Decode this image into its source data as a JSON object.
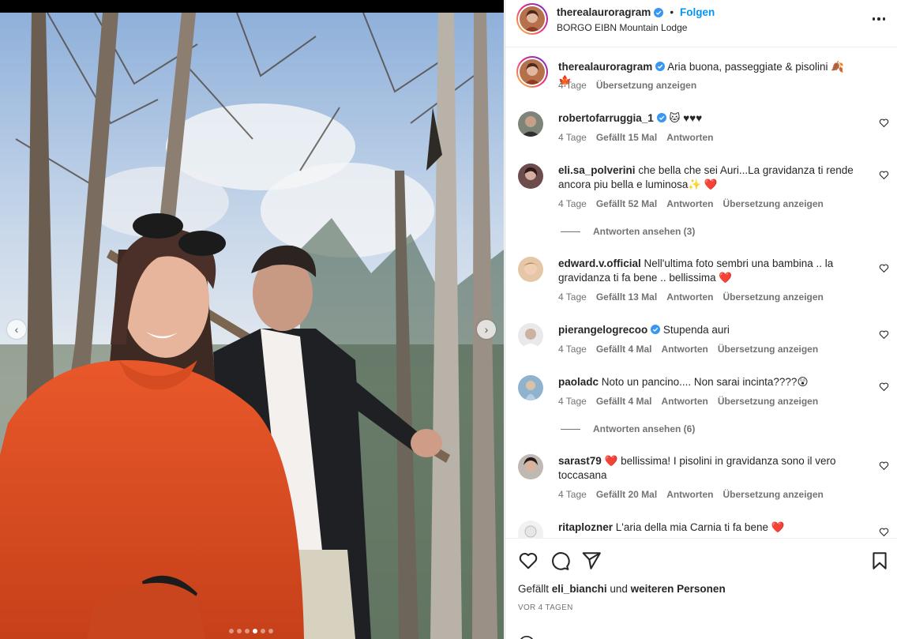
{
  "post": {
    "username": "therealauroragram",
    "verified": true,
    "separator": "•",
    "follow_label": "Folgen",
    "location": "BORGO EIBN Mountain Lodge",
    "more_icon": "more-horizontal-icon"
  },
  "media": {
    "prev_icon": "‹",
    "next_icon": "›",
    "slide_count": 6,
    "active_slide": 4
  },
  "caption": {
    "username": "therealauroragram",
    "text": "Aria buona, passeggiate & pisolini 🍂 🍁",
    "time": "4 Tage",
    "translate": "Übersetzung anzeigen"
  },
  "comments": [
    {
      "username": "robertofarruggia_1",
      "verified": true,
      "text": "🐱 ♥♥♥",
      "time": "4 Tage",
      "likes": "Gefällt 15 Mal",
      "reply": "Antworten",
      "translate": ""
    },
    {
      "username": "eli.sa_polverini",
      "verified": false,
      "text": "che bella che sei Auri...La gravidanza ti rende ancora piu bella e luminosa✨ ❤️",
      "time": "4 Tage",
      "likes": "Gefällt 52 Mal",
      "reply": "Antworten",
      "translate": "Übersetzung anzeigen",
      "view_replies": "Antworten ansehen (3)"
    },
    {
      "username": "edward.v.official",
      "verified": false,
      "text": "Nell'ultima foto sembri una bambina .. la gravidanza ti fa bene .. bellissima ❤️",
      "time": "4 Tage",
      "likes": "Gefällt 13 Mal",
      "reply": "Antworten",
      "translate": "Übersetzung anzeigen"
    },
    {
      "username": "pierangelogrecoo",
      "verified": true,
      "text": "Stupenda auri",
      "time": "4 Tage",
      "likes": "Gefällt 4 Mal",
      "reply": "Antworten",
      "translate": "Übersetzung anzeigen"
    },
    {
      "username": "paoladc",
      "verified": false,
      "text": "Noto un pancino.... Non sarai incinta????😲",
      "time": "4 Tage",
      "likes": "Gefällt 4 Mal",
      "reply": "Antworten",
      "translate": "Übersetzung anzeigen",
      "view_replies": "Antworten ansehen (6)"
    },
    {
      "username": "sarast79",
      "verified": false,
      "text": "❤️ bellissima! I pisolini in gravidanza sono il vero toccasana",
      "time": "4 Tage",
      "likes": "Gefällt 20 Mal",
      "reply": "Antworten",
      "translate": "Übersetzung anzeigen"
    },
    {
      "username": "ritaplozner",
      "verified": false,
      "text": "L'aria della mia Carnia ti fa bene ❤️",
      "time": "",
      "likes": "",
      "reply": "",
      "translate": ""
    }
  ],
  "actions": {
    "like_icon": "heart-icon",
    "comment_icon": "comment-icon",
    "share_icon": "share-icon",
    "save_icon": "bookmark-icon",
    "liked_by_prefix": "Gefällt",
    "liked_by_user": "eli_bianchi",
    "liked_by_and": "und",
    "liked_by_others": "weiteren Personen",
    "date": "VOR 4 TAGEN"
  },
  "colors": {
    "accent": "#0095f6",
    "verified": "#3897f0",
    "text": "#262626",
    "muted": "#737373"
  }
}
